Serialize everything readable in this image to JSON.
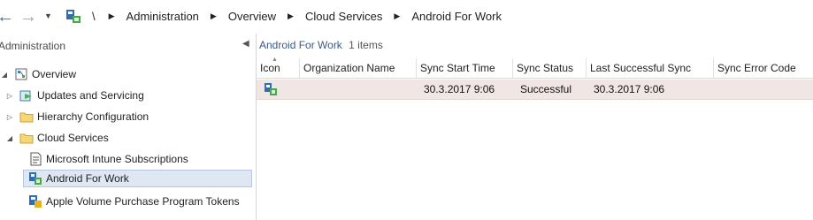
{
  "breadcrumb": {
    "root": "\\",
    "items": [
      "Administration",
      "Overview",
      "Cloud Services",
      "Android For Work"
    ]
  },
  "nav": {
    "back_icon": "arrow-left-icon",
    "forward_icon": "arrow-right-icon",
    "history_icon": "chevron-down-icon"
  },
  "left_pane": {
    "title": "Administration",
    "tree": [
      {
        "label": "Overview",
        "icon": "overview-node-icon",
        "expander": "expanded"
      },
      {
        "label": "Updates and Servicing",
        "icon": "updates-icon",
        "expander": "collapsed"
      },
      {
        "label": "Hierarchy Configuration",
        "icon": "folder-icon",
        "expander": "collapsed"
      },
      {
        "label": "Cloud Services",
        "icon": "folder-icon",
        "expander": "expanded"
      },
      {
        "label": "Microsoft Intune Subscriptions",
        "icon": "document-icon",
        "expander": "none"
      },
      {
        "label": "Android For Work",
        "icon": "android-for-work-icon",
        "expander": "none",
        "selected": true
      },
      {
        "label": "Apple Volume Purchase Program Tokens",
        "icon": "vpp-token-icon",
        "expander": "none"
      }
    ]
  },
  "results": {
    "title": "Android For Work",
    "count_text": "1 items",
    "columns": [
      "Icon",
      "Organization Name",
      "Sync Start Time",
      "Sync Status",
      "Last Successful Sync",
      "Sync Error Code"
    ],
    "rows": [
      {
        "icon": "android-for-work-icon",
        "organization_name": "",
        "sync_start_time": "30.3.2017 9:06",
        "sync_status": "Successful",
        "last_successful_sync": "30.3.2017 9:06",
        "sync_error_code": ""
      }
    ]
  },
  "colors": {
    "selected_row": "#f0e6e4",
    "tree_selection": "#dfe7f2",
    "title_text": "#3c5a85"
  }
}
